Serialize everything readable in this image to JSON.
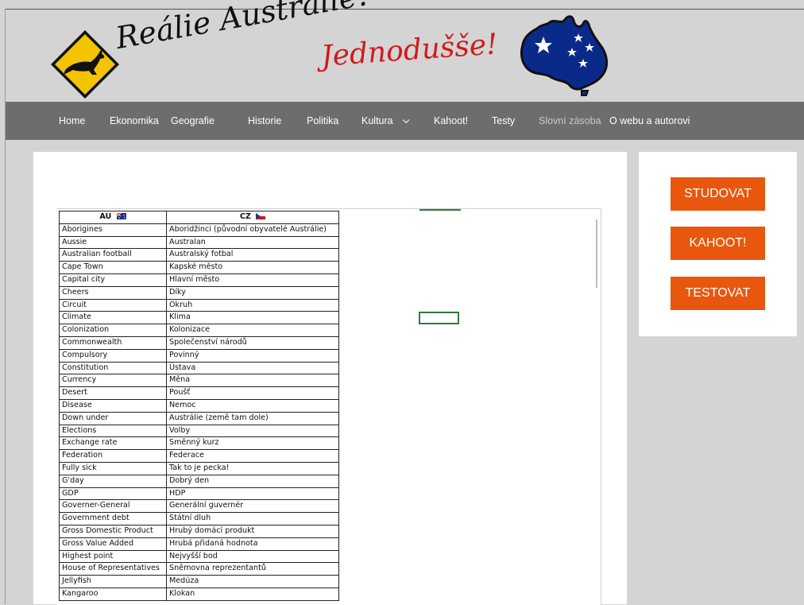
{
  "header": {
    "title_part1": "Reálie Austrálie?",
    "title_part2": "Jednodušše!",
    "logo_icon": "kangaroo-sign-icon",
    "map_icon": "australia-map-icon"
  },
  "nav": {
    "items": [
      {
        "label": "Home"
      },
      {
        "label": "Ekonomika"
      },
      {
        "label": "Geografie"
      },
      {
        "label": "Historie"
      },
      {
        "label": "Politika"
      },
      {
        "label": "Kultura"
      },
      {
        "label": "Kahoot!"
      },
      {
        "label": "Testy"
      },
      {
        "label": "Slovní zásoba"
      },
      {
        "label": "O webu a autorovi"
      }
    ],
    "dropdown_icon": "chevron-down-icon"
  },
  "sidebar": {
    "buttons": [
      {
        "label": "STUDOVAT"
      },
      {
        "label": "KAHOOT!"
      },
      {
        "label": "TESTOVAT"
      }
    ]
  },
  "vocab": {
    "headers": [
      "AU",
      "CZ"
    ],
    "rows": [
      [
        "Aborigines",
        "Aboridžinci (původní obyvatelé Austrálie)"
      ],
      [
        "Aussie",
        "Australan"
      ],
      [
        "Australian football",
        "Australský fotbal"
      ],
      [
        "Cape Town",
        "Kapské město"
      ],
      [
        "Capital city",
        "Hlavní město"
      ],
      [
        "Cheers",
        "Díky"
      ],
      [
        "Circuit",
        "Okruh"
      ],
      [
        "Climate",
        "Klima"
      ],
      [
        "Colonization",
        "Kolonizace"
      ],
      [
        "Commonwealth",
        "Společenství národů"
      ],
      [
        "Compulsory",
        "Povinný"
      ],
      [
        "Constitution",
        "Ústava"
      ],
      [
        "Currency",
        "Měna"
      ],
      [
        "Desert",
        "Poušť"
      ],
      [
        "Disease",
        "Nemoc"
      ],
      [
        "Down under",
        "Austrálie (země tam dole)"
      ],
      [
        "Elections",
        "Volby"
      ],
      [
        "Exchange rate",
        "Směnný kurz"
      ],
      [
        "Federation",
        "Federace"
      ],
      [
        "Fully sick",
        "Tak to je pecka!"
      ],
      [
        "G'day",
        "Dobrý den"
      ],
      [
        "GDP",
        "HDP"
      ],
      [
        "Governer-General",
        "Generální guvernér"
      ],
      [
        "Government debt",
        "Státní dluh"
      ],
      [
        "Gross Domestic Product",
        "Hrubý domácí produkt"
      ],
      [
        "Gross Value Added",
        "Hrubá přidaná hodnota"
      ],
      [
        "Highest point",
        "Nejvyšší bod"
      ],
      [
        "House of Representatives",
        "Sněmovna reprezentantů"
      ],
      [
        "Jellyfish",
        "Medúza"
      ],
      [
        "Kangaroo",
        "Klokan"
      ]
    ]
  },
  "colors": {
    "accent_button": "#e8570d",
    "nav_bg": "#6d6d6d",
    "page_bg": "#d4d4d4",
    "title_red": "#d11a1a",
    "selection_green": "#2e7d3c"
  }
}
